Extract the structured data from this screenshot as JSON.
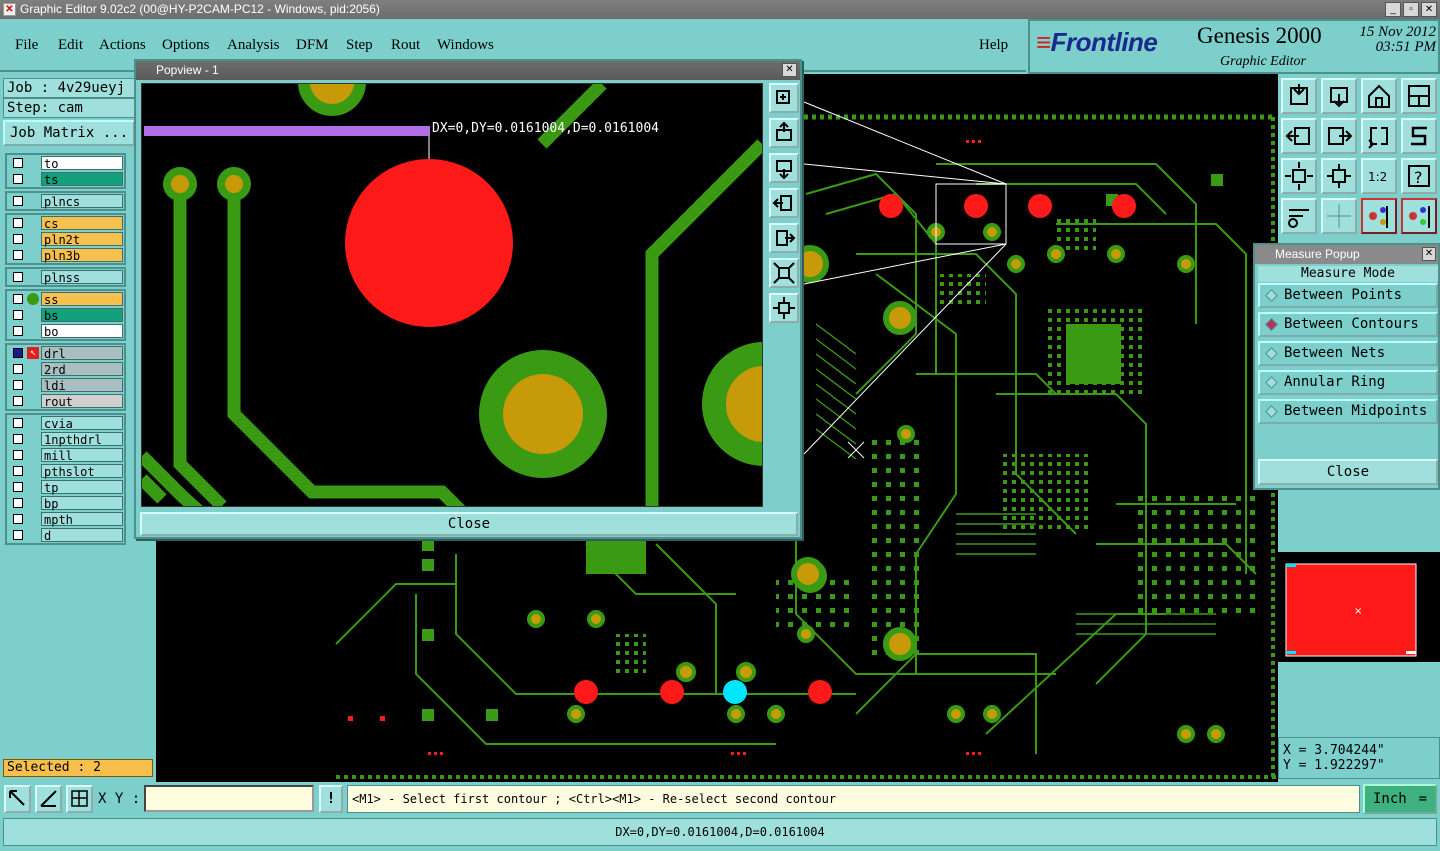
{
  "window": {
    "title": "Graphic Editor 9.02c2 (00@HY-P2CAM-PC12 - Windows, pid:2056)",
    "controls": [
      "_",
      "▫",
      "✕"
    ]
  },
  "menu": [
    "File",
    "Edit",
    "Actions",
    "Options",
    "Analysis",
    "DFM",
    "Step",
    "Rout",
    "Windows"
  ],
  "help_label": "Help",
  "brand": {
    "logo": "Frontline",
    "product": "Genesis 2000",
    "subtitle": "Graphic Editor",
    "date": "15 Nov 2012",
    "time": "03:51 PM"
  },
  "job": {
    "job_label": "Job : 4v29ueyj",
    "step_label": "Step: cam",
    "matrix_button": "Job Matrix ..."
  },
  "layer_groups": [
    [
      {
        "name": "to",
        "color": "#ffffff"
      },
      {
        "name": "ts",
        "color": "#13a07a"
      }
    ],
    [
      {
        "name": "plncs",
        "color": "#9fe0dd"
      }
    ],
    [
      {
        "name": "cs",
        "color": "#f7c04e"
      },
      {
        "name": "pln2t",
        "color": "#f7c04e"
      },
      {
        "name": "pln3b",
        "color": "#f7c04e"
      }
    ],
    [
      {
        "name": "plnss",
        "color": "#9fe0dd"
      }
    ],
    [
      {
        "name": "ss",
        "color": "#f7c04e",
        "mark": "green-dot"
      },
      {
        "name": "bs",
        "color": "#13a07a"
      },
      {
        "name": "bo",
        "color": "#ffffff"
      }
    ],
    [
      {
        "name": "drl",
        "color": "#a9bec0",
        "mark": "edit-arrow"
      },
      {
        "name": "2rd",
        "color": "#a9bec0"
      },
      {
        "name": "ldi",
        "color": "#a9bec0"
      },
      {
        "name": "rout",
        "color": "#cfcfcf"
      }
    ],
    [
      {
        "name": "cvia",
        "color": "#9fe0dd"
      },
      {
        "name": "1npthdrl",
        "color": "#9fe0dd"
      },
      {
        "name": "mill",
        "color": "#9fe0dd"
      },
      {
        "name": "pthslot",
        "color": "#9fe0dd"
      },
      {
        "name": "tp",
        "color": "#9fe0dd"
      },
      {
        "name": "bp",
        "color": "#9fe0dd"
      },
      {
        "name": "mpth",
        "color": "#9fe0dd"
      },
      {
        "name": "d",
        "color": "#9fe0dd"
      }
    ]
  ],
  "selected_label": "Selected : 2",
  "popview": {
    "title": "Popview - 1",
    "measure_text": "DX=0,DY=0.0161004,D=0.0161004",
    "close_label": "Close"
  },
  "measure_popup": {
    "title": "Measure Popup",
    "mode_label": "Measure Mode",
    "options": [
      {
        "label": "Between Points",
        "selected": false
      },
      {
        "label": "Between Contours",
        "selected": true
      },
      {
        "label": "Between Nets",
        "selected": false
      },
      {
        "label": "Annular Ring",
        "selected": false
      },
      {
        "label": "Between Midpoints",
        "selected": false
      }
    ],
    "close_label": "Close"
  },
  "coords": {
    "x": "X = 3.704244\"",
    "y": "Y = 1.922297\""
  },
  "bottom": {
    "xy_label": "X Y :",
    "xy_value": "",
    "warn_label": "!",
    "prompt": "<M1> - Select first contour ; <Ctrl><M1> - Re-select second contour",
    "units": "Inch",
    "status": "DX=0,DY=0.0161004,D=0.0161004"
  },
  "colors": {
    "panel": "#7ccfcb",
    "trace": "#3a9a14",
    "pad_red": "#ff1a1a",
    "drill_gold": "#c79a0a",
    "measure_bar": "#b06ee8",
    "highlight_cyan": "#00e5ff"
  }
}
